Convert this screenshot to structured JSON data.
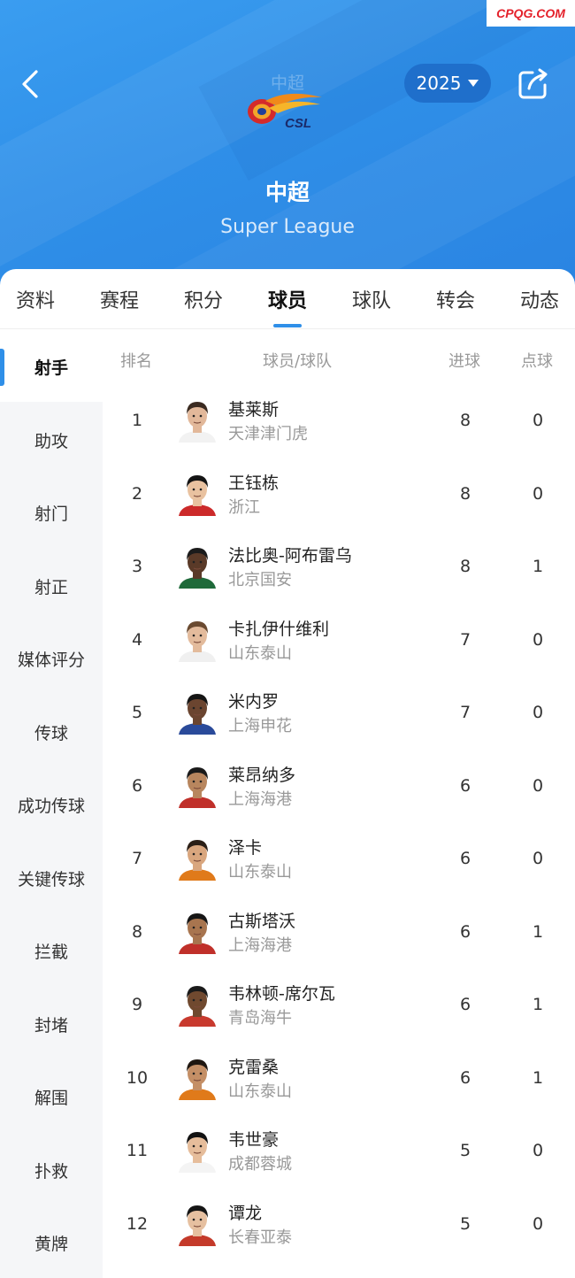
{
  "watermark": "CPQG.COM",
  "header": {
    "mini_title": "中超",
    "logo_text": "CSL",
    "year": "2025",
    "league_name": "中超",
    "league_name_en": "Super League"
  },
  "tabs": [
    {
      "label": "资料",
      "active": false
    },
    {
      "label": "赛程",
      "active": false
    },
    {
      "label": "积分",
      "active": false
    },
    {
      "label": "球员",
      "active": true
    },
    {
      "label": "球队",
      "active": false
    },
    {
      "label": "转会",
      "active": false
    },
    {
      "label": "动态",
      "active": false
    }
  ],
  "side_menu": [
    {
      "label": "射手",
      "active": true
    },
    {
      "label": "助攻",
      "active": false
    },
    {
      "label": "射门",
      "active": false
    },
    {
      "label": "射正",
      "active": false
    },
    {
      "label": "媒体评分",
      "active": false
    },
    {
      "label": "传球",
      "active": false
    },
    {
      "label": "成功传球",
      "active": false
    },
    {
      "label": "关键传球",
      "active": false
    },
    {
      "label": "拦截",
      "active": false
    },
    {
      "label": "封堵",
      "active": false
    },
    {
      "label": "解围",
      "active": false
    },
    {
      "label": "扑救",
      "active": false
    },
    {
      "label": "黄牌",
      "active": false
    }
  ],
  "table": {
    "headers": {
      "rank": "排名",
      "player": "球员/球队",
      "goals": "进球",
      "penalties": "点球"
    },
    "rows": [
      {
        "rank": "1",
        "name": "基莱斯",
        "team": "天津津门虎",
        "goals": "8",
        "penalties": "0",
        "skin": "#e2b89a",
        "hair": "#3a2a20",
        "shirt": "#f2f2f2"
      },
      {
        "rank": "2",
        "name": "王钰栋",
        "team": "浙江",
        "goals": "8",
        "penalties": "0",
        "skin": "#e9c2a0",
        "hair": "#141414",
        "shirt": "#cc2a2a"
      },
      {
        "rank": "3",
        "name": "法比奥-阿布雷乌",
        "team": "北京国安",
        "goals": "8",
        "penalties": "1",
        "skin": "#5a3a28",
        "hair": "#1b1b1b",
        "shirt": "#1f6a3a"
      },
      {
        "rank": "4",
        "name": "卡扎伊什维利",
        "team": "山东泰山",
        "goals": "7",
        "penalties": "0",
        "skin": "#e3bb9c",
        "hair": "#6a4a30",
        "shirt": "#f0f0f0"
      },
      {
        "rank": "5",
        "name": "米内罗",
        "team": "上海申花",
        "goals": "7",
        "penalties": "0",
        "skin": "#6b4530",
        "hair": "#151515",
        "shirt": "#2a4a9a"
      },
      {
        "rank": "6",
        "name": "莱昂纳多",
        "team": "上海海港",
        "goals": "6",
        "penalties": "0",
        "skin": "#b8865e",
        "hair": "#1a1a1a",
        "shirt": "#c0302a"
      },
      {
        "rank": "7",
        "name": "泽卡",
        "team": "山东泰山",
        "goals": "6",
        "penalties": "0",
        "skin": "#d9a67e",
        "hair": "#2a1e16",
        "shirt": "#e07a1a"
      },
      {
        "rank": "8",
        "name": "古斯塔沃",
        "team": "上海海港",
        "goals": "6",
        "penalties": "1",
        "skin": "#a8754f",
        "hair": "#161616",
        "shirt": "#c0302a"
      },
      {
        "rank": "9",
        "name": "韦林顿-席尔瓦",
        "team": "青岛海牛",
        "goals": "6",
        "penalties": "1",
        "skin": "#70492f",
        "hair": "#1a1a1a",
        "shirt": "#c83a2e"
      },
      {
        "rank": "10",
        "name": "克雷桑",
        "team": "山东泰山",
        "goals": "6",
        "penalties": "1",
        "skin": "#c48f66",
        "hair": "#1e1610",
        "shirt": "#e07a1a"
      },
      {
        "rank": "11",
        "name": "韦世豪",
        "team": "成都蓉城",
        "goals": "5",
        "penalties": "0",
        "skin": "#e6bd9b",
        "hair": "#121212",
        "shirt": "#f4f4f4"
      },
      {
        "rank": "12",
        "name": "谭龙",
        "team": "长春亚泰",
        "goals": "5",
        "penalties": "0",
        "skin": "#e6c0a0",
        "hair": "#151515",
        "shirt": "#c43a2a"
      }
    ]
  },
  "colors": {
    "accent": "#2f8fe8",
    "header_bg": "#3a9df0",
    "year_pill": "#1f6fcb",
    "watermark": "#e4202a"
  }
}
